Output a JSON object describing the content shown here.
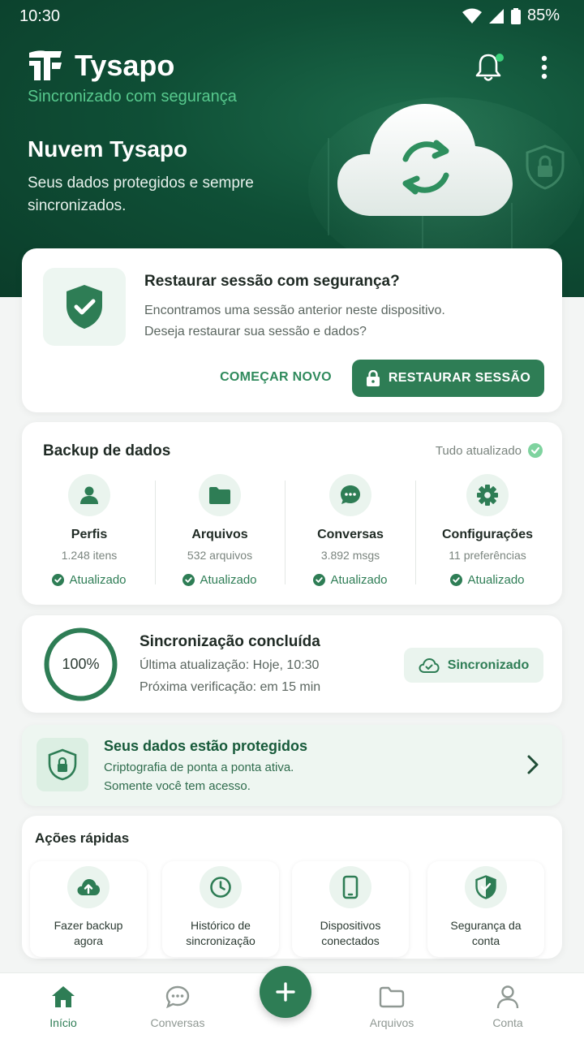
{
  "status_bar": {
    "time": "10:30",
    "battery": "85%"
  },
  "header": {
    "app_name": "Tysapo",
    "subtitle": "Sincronizado com segurança",
    "hero_title": "Nuvem Tysapo",
    "hero_subtitle": "Seus dados protegidos e sempre sincronizados."
  },
  "restore_card": {
    "title": "Restaurar sessão com segurança?",
    "description": "Encontramos uma sessão anterior neste dispositivo. Deseja restaurar sua sessão e dados?",
    "start_new_label": "COMEÇAR NOVO",
    "restore_label": "RESTAURAR SESSÃO"
  },
  "backup": {
    "title": "Backup de dados",
    "status": "Tudo atualizado",
    "items": [
      {
        "label": "Perfis",
        "count": "1.248 itens",
        "state": "Atualizado",
        "icon": "person-icon"
      },
      {
        "label": "Arquivos",
        "count": "532 arquivos",
        "state": "Atualizado",
        "icon": "folder-icon"
      },
      {
        "label": "Conversas",
        "count": "3.892 msgs",
        "state": "Atualizado",
        "icon": "chat-icon"
      },
      {
        "label": "Configurações",
        "count": "11 preferências",
        "state": "Atualizado",
        "icon": "gear-icon"
      }
    ]
  },
  "sync": {
    "progress": "100%",
    "title": "Sincronização concluída",
    "last_update": "Última atualização: Hoje, 10:30",
    "next_check": "Próxima verificação: em 15 min",
    "status_label": "Sincronizado"
  },
  "protection": {
    "title": "Seus dados estão protegidos",
    "line1": "Criptografia de ponta a ponta ativa.",
    "line2": "Somente você tem acesso."
  },
  "quick_actions": {
    "title": "Ações rápidas",
    "items": [
      {
        "label": "Fazer backup agora",
        "icon": "cloud-upload-icon"
      },
      {
        "label": "Histórico de sincronização",
        "icon": "clock-icon"
      },
      {
        "label": "Dispositivos conectados",
        "icon": "phone-icon"
      },
      {
        "label": "Segurança da conta",
        "icon": "shield-icon"
      }
    ]
  },
  "bottom_nav": {
    "items": [
      {
        "label": "Início",
        "active": true
      },
      {
        "label": "Conversas",
        "active": false
      },
      {
        "label": "Arquivos",
        "active": false
      },
      {
        "label": "Conta",
        "active": false
      }
    ]
  },
  "colors": {
    "primary": "#2e7d55",
    "hero_dark": "#0b3d2a",
    "accent": "#57c98d"
  }
}
